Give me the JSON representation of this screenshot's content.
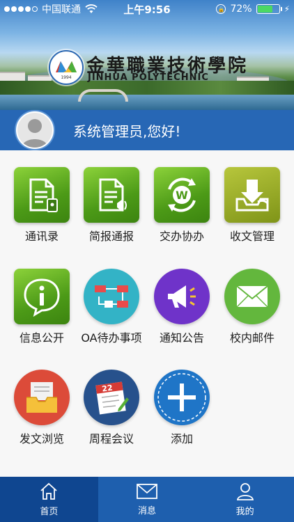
{
  "status_bar": {
    "carrier": "中国联通",
    "time": "上午9:56",
    "battery": "72%",
    "battery_level": 0.72
  },
  "banner": {
    "school_name": "金華職業技術學院",
    "school_name_en": "JINHUA POLYTECHNIC",
    "logo_year": "1994"
  },
  "user": {
    "greeting": "系统管理员,您好!"
  },
  "apps": [
    {
      "label": "通讯录",
      "icon": "contacts-document-icon",
      "color": "#5aa81e"
    },
    {
      "label": "简报通报",
      "icon": "bulletin-document-icon",
      "color": "#5aa81e"
    },
    {
      "label": "交办协办",
      "icon": "assignment-w-icon",
      "color": "#5aa81e"
    },
    {
      "label": "收文管理",
      "icon": "inbox-download-icon",
      "color": "#98a923"
    },
    {
      "label": "信息公开",
      "icon": "info-bubble-icon",
      "color": "#5aa81e"
    },
    {
      "label": "OA待办事项",
      "icon": "workflow-icon",
      "color": "#33b3c6"
    },
    {
      "label": "通知公告",
      "icon": "megaphone-icon",
      "color": "#6f33c9"
    },
    {
      "label": "校内邮件",
      "icon": "envelope-icon",
      "color": "#63b73d"
    },
    {
      "label": "发文浏览",
      "icon": "outbox-tray-icon",
      "color": "#dc4b39"
    },
    {
      "label": "周程会议",
      "icon": "calendar-icon",
      "color": "#27518c",
      "badge": "22"
    },
    {
      "label": "添加",
      "icon": "plus-icon",
      "color": "#1f75c7"
    }
  ],
  "tabbar": {
    "items": [
      {
        "label": "首页",
        "icon": "home-icon",
        "active": true
      },
      {
        "label": "消息",
        "icon": "mail-icon",
        "active": false
      },
      {
        "label": "我的",
        "icon": "user-icon",
        "active": false
      }
    ]
  }
}
